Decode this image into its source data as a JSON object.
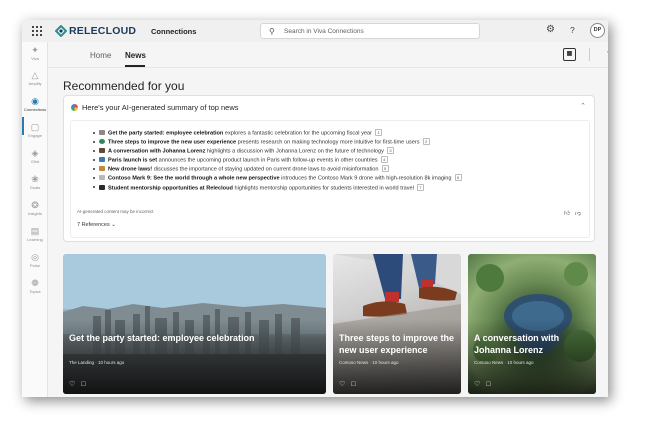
{
  "brand": {
    "name": "RELECLOUD",
    "app": "Connections"
  },
  "search": {
    "placeholder": "Search in Viva Connections"
  },
  "header": {
    "avatar_initials": "DP"
  },
  "rail": [
    {
      "label": "Viva",
      "icon": "viva-icon"
    },
    {
      "label": "Amplify",
      "icon": "amplify-icon"
    },
    {
      "label": "Connections",
      "icon": "connections-icon",
      "active": true
    },
    {
      "label": "Engage",
      "icon": "engage-icon"
    },
    {
      "label": "Glint",
      "icon": "glint-icon"
    },
    {
      "label": "Goals",
      "icon": "goals-icon"
    },
    {
      "label": "Insights",
      "icon": "insights-icon"
    },
    {
      "label": "Learning",
      "icon": "learning-icon"
    },
    {
      "label": "Pulse",
      "icon": "pulse-icon"
    },
    {
      "label": "Topics",
      "icon": "topics-icon"
    }
  ],
  "nav": {
    "tabs": [
      {
        "label": "Home"
      },
      {
        "label": "News",
        "active": true
      }
    ]
  },
  "page": {
    "heading": "Recommended for you"
  },
  "summary": {
    "title": "Here's your AI-generated summary of top news",
    "items": [
      {
        "bold": "Get the party started: employee celebration",
        "rest": " explores a fantastic celebration for the upcoming fiscal year",
        "ref": "1"
      },
      {
        "bold": "Three steps to improve the new user experience",
        "rest": " presents research on making technology more intuitive for first-time users",
        "ref": "2"
      },
      {
        "bold": "A conversation with Johanna Lorenz",
        "rest": " highlights a discussion with Johanna Lorenz on the future of technology",
        "ref": "3"
      },
      {
        "bold": "Paris launch is set",
        "rest": " announces the upcoming product launch in Paris with follow-up events in other countries",
        "ref": "4"
      },
      {
        "bold": "New drone laws!",
        "rest": " discusses the importance of staying updated on current drone laws to avoid misinformation",
        "ref": "5"
      },
      {
        "bold": "Contoso Mark 9: See the world through a whole new perspective",
        "rest": " introduces the Contoso Mark 9 drone with high-resolution 8k imaging",
        "ref": "6"
      },
      {
        "bold": "Student mentorship opportunities at Relecloud",
        "rest": " highlights mentorship opportunities for students interested in world travel",
        "ref": "7"
      }
    ],
    "disclaimer": "AI-generated content may be incorrect",
    "references": "7 References"
  },
  "cards": [
    {
      "title": "Get the party started: employee celebration",
      "meta": "The Landing · 10 hours ago"
    },
    {
      "title": "Three steps to improve the new user experience",
      "meta": "Contoso News · 10 hours ago"
    },
    {
      "title": "A conversation with Johanna Lorenz",
      "meta": "Contoso News · 10 hours ago"
    }
  ],
  "colors": {
    "accent": "#2a7ab0",
    "brand": "#1b3a5c"
  }
}
